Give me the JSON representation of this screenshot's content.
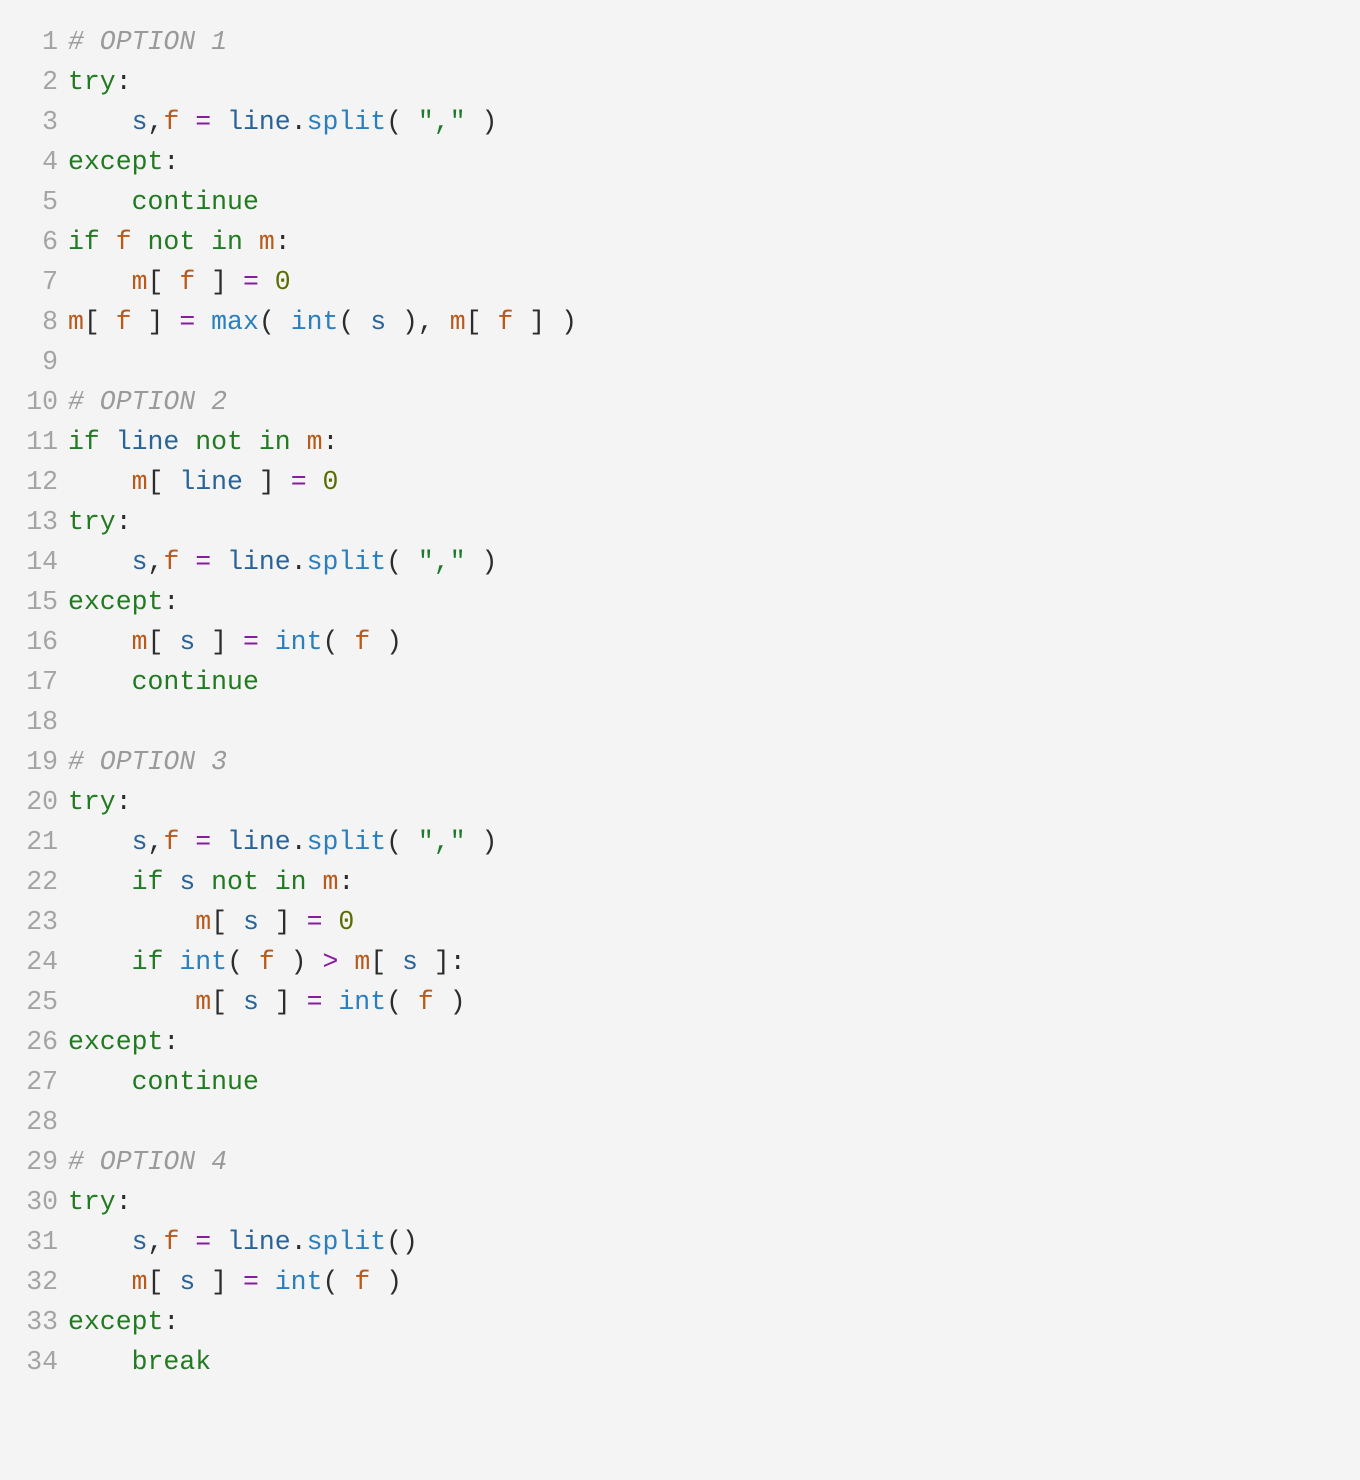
{
  "lines": [
    {
      "n": "1",
      "tokens": [
        {
          "c": "tok-cm",
          "t": "# OPTION 1"
        }
      ]
    },
    {
      "n": "2",
      "tokens": [
        {
          "c": "tok-kw",
          "t": "try"
        },
        {
          "c": "tok-id",
          "t": ":"
        }
      ]
    },
    {
      "n": "3",
      "tokens": [
        {
          "c": "tok-id",
          "t": "    "
        },
        {
          "c": "tok-v1",
          "t": "s"
        },
        {
          "c": "tok-id",
          "t": ","
        },
        {
          "c": "tok-v2",
          "t": "f"
        },
        {
          "c": "tok-id",
          "t": " "
        },
        {
          "c": "tok-op",
          "t": "="
        },
        {
          "c": "tok-id",
          "t": " "
        },
        {
          "c": "tok-v1",
          "t": "line"
        },
        {
          "c": "tok-id",
          "t": "."
        },
        {
          "c": "tok-fn",
          "t": "split"
        },
        {
          "c": "tok-id",
          "t": "( "
        },
        {
          "c": "tok-st",
          "t": "\",\""
        },
        {
          "c": "tok-id",
          "t": " )"
        }
      ]
    },
    {
      "n": "4",
      "tokens": [
        {
          "c": "tok-kw",
          "t": "except"
        },
        {
          "c": "tok-id",
          "t": ":"
        }
      ]
    },
    {
      "n": "5",
      "tokens": [
        {
          "c": "tok-id",
          "t": "    "
        },
        {
          "c": "tok-kw",
          "t": "continue"
        }
      ]
    },
    {
      "n": "6",
      "tokens": [
        {
          "c": "tok-kw",
          "t": "if"
        },
        {
          "c": "tok-id",
          "t": " "
        },
        {
          "c": "tok-v2",
          "t": "f"
        },
        {
          "c": "tok-id",
          "t": " "
        },
        {
          "c": "tok-kw",
          "t": "not in"
        },
        {
          "c": "tok-id",
          "t": " "
        },
        {
          "c": "tok-v2",
          "t": "m"
        },
        {
          "c": "tok-id",
          "t": ":"
        }
      ]
    },
    {
      "n": "7",
      "tokens": [
        {
          "c": "tok-id",
          "t": "    "
        },
        {
          "c": "tok-v2",
          "t": "m"
        },
        {
          "c": "tok-id",
          "t": "[ "
        },
        {
          "c": "tok-v2",
          "t": "f"
        },
        {
          "c": "tok-id",
          "t": " ] "
        },
        {
          "c": "tok-op",
          "t": "="
        },
        {
          "c": "tok-id",
          "t": " "
        },
        {
          "c": "tok-nu",
          "t": "0"
        }
      ]
    },
    {
      "n": "8",
      "tokens": [
        {
          "c": "tok-v2",
          "t": "m"
        },
        {
          "c": "tok-id",
          "t": "[ "
        },
        {
          "c": "tok-v2",
          "t": "f"
        },
        {
          "c": "tok-id",
          "t": " ] "
        },
        {
          "c": "tok-op",
          "t": "="
        },
        {
          "c": "tok-id",
          "t": " "
        },
        {
          "c": "tok-fn",
          "t": "max"
        },
        {
          "c": "tok-id",
          "t": "( "
        },
        {
          "c": "tok-fn",
          "t": "int"
        },
        {
          "c": "tok-id",
          "t": "( "
        },
        {
          "c": "tok-v1",
          "t": "s"
        },
        {
          "c": "tok-id",
          "t": " ), "
        },
        {
          "c": "tok-v2",
          "t": "m"
        },
        {
          "c": "tok-id",
          "t": "[ "
        },
        {
          "c": "tok-v2",
          "t": "f"
        },
        {
          "c": "tok-id",
          "t": " ] )"
        }
      ]
    },
    {
      "n": "9",
      "tokens": []
    },
    {
      "n": "10",
      "tokens": [
        {
          "c": "tok-cm",
          "t": "# OPTION 2"
        }
      ]
    },
    {
      "n": "11",
      "tokens": [
        {
          "c": "tok-kw",
          "t": "if"
        },
        {
          "c": "tok-id",
          "t": " "
        },
        {
          "c": "tok-v1",
          "t": "line"
        },
        {
          "c": "tok-id",
          "t": " "
        },
        {
          "c": "tok-kw",
          "t": "not in"
        },
        {
          "c": "tok-id",
          "t": " "
        },
        {
          "c": "tok-v2",
          "t": "m"
        },
        {
          "c": "tok-id",
          "t": ":"
        }
      ]
    },
    {
      "n": "12",
      "tokens": [
        {
          "c": "tok-id",
          "t": "    "
        },
        {
          "c": "tok-v2",
          "t": "m"
        },
        {
          "c": "tok-id",
          "t": "[ "
        },
        {
          "c": "tok-v1",
          "t": "line"
        },
        {
          "c": "tok-id",
          "t": " ] "
        },
        {
          "c": "tok-op",
          "t": "="
        },
        {
          "c": "tok-id",
          "t": " "
        },
        {
          "c": "tok-nu",
          "t": "0"
        }
      ]
    },
    {
      "n": "13",
      "tokens": [
        {
          "c": "tok-kw",
          "t": "try"
        },
        {
          "c": "tok-id",
          "t": ":"
        }
      ]
    },
    {
      "n": "14",
      "tokens": [
        {
          "c": "tok-id",
          "t": "    "
        },
        {
          "c": "tok-v1",
          "t": "s"
        },
        {
          "c": "tok-id",
          "t": ","
        },
        {
          "c": "tok-v2",
          "t": "f"
        },
        {
          "c": "tok-id",
          "t": " "
        },
        {
          "c": "tok-op",
          "t": "="
        },
        {
          "c": "tok-id",
          "t": " "
        },
        {
          "c": "tok-v1",
          "t": "line"
        },
        {
          "c": "tok-id",
          "t": "."
        },
        {
          "c": "tok-fn",
          "t": "split"
        },
        {
          "c": "tok-id",
          "t": "( "
        },
        {
          "c": "tok-st",
          "t": "\",\""
        },
        {
          "c": "tok-id",
          "t": " )"
        }
      ]
    },
    {
      "n": "15",
      "tokens": [
        {
          "c": "tok-kw",
          "t": "except"
        },
        {
          "c": "tok-id",
          "t": ":"
        }
      ]
    },
    {
      "n": "16",
      "tokens": [
        {
          "c": "tok-id",
          "t": "    "
        },
        {
          "c": "tok-v2",
          "t": "m"
        },
        {
          "c": "tok-id",
          "t": "[ "
        },
        {
          "c": "tok-v1",
          "t": "s"
        },
        {
          "c": "tok-id",
          "t": " ] "
        },
        {
          "c": "tok-op",
          "t": "="
        },
        {
          "c": "tok-id",
          "t": " "
        },
        {
          "c": "tok-fn",
          "t": "int"
        },
        {
          "c": "tok-id",
          "t": "( "
        },
        {
          "c": "tok-v2",
          "t": "f"
        },
        {
          "c": "tok-id",
          "t": " )"
        }
      ]
    },
    {
      "n": "17",
      "tokens": [
        {
          "c": "tok-id",
          "t": "    "
        },
        {
          "c": "tok-kw",
          "t": "continue"
        }
      ]
    },
    {
      "n": "18",
      "tokens": []
    },
    {
      "n": "19",
      "tokens": [
        {
          "c": "tok-cm",
          "t": "# OPTION 3"
        }
      ]
    },
    {
      "n": "20",
      "tokens": [
        {
          "c": "tok-kw",
          "t": "try"
        },
        {
          "c": "tok-id",
          "t": ":"
        }
      ]
    },
    {
      "n": "21",
      "tokens": [
        {
          "c": "tok-id",
          "t": "    "
        },
        {
          "c": "tok-v1",
          "t": "s"
        },
        {
          "c": "tok-id",
          "t": ","
        },
        {
          "c": "tok-v2",
          "t": "f"
        },
        {
          "c": "tok-id",
          "t": " "
        },
        {
          "c": "tok-op",
          "t": "="
        },
        {
          "c": "tok-id",
          "t": " "
        },
        {
          "c": "tok-v1",
          "t": "line"
        },
        {
          "c": "tok-id",
          "t": "."
        },
        {
          "c": "tok-fn",
          "t": "split"
        },
        {
          "c": "tok-id",
          "t": "( "
        },
        {
          "c": "tok-st",
          "t": "\",\""
        },
        {
          "c": "tok-id",
          "t": " )"
        }
      ]
    },
    {
      "n": "22",
      "tokens": [
        {
          "c": "tok-id",
          "t": "    "
        },
        {
          "c": "tok-kw",
          "t": "if"
        },
        {
          "c": "tok-id",
          "t": " "
        },
        {
          "c": "tok-v1",
          "t": "s"
        },
        {
          "c": "tok-id",
          "t": " "
        },
        {
          "c": "tok-kw",
          "t": "not in"
        },
        {
          "c": "tok-id",
          "t": " "
        },
        {
          "c": "tok-v2",
          "t": "m"
        },
        {
          "c": "tok-id",
          "t": ":"
        }
      ]
    },
    {
      "n": "23",
      "tokens": [
        {
          "c": "tok-id",
          "t": "        "
        },
        {
          "c": "tok-v2",
          "t": "m"
        },
        {
          "c": "tok-id",
          "t": "[ "
        },
        {
          "c": "tok-v1",
          "t": "s"
        },
        {
          "c": "tok-id",
          "t": " ] "
        },
        {
          "c": "tok-op",
          "t": "="
        },
        {
          "c": "tok-id",
          "t": " "
        },
        {
          "c": "tok-nu",
          "t": "0"
        }
      ]
    },
    {
      "n": "24",
      "tokens": [
        {
          "c": "tok-id",
          "t": "    "
        },
        {
          "c": "tok-kw",
          "t": "if"
        },
        {
          "c": "tok-id",
          "t": " "
        },
        {
          "c": "tok-fn",
          "t": "int"
        },
        {
          "c": "tok-id",
          "t": "( "
        },
        {
          "c": "tok-v2",
          "t": "f"
        },
        {
          "c": "tok-id",
          "t": " ) "
        },
        {
          "c": "tok-op",
          "t": ">"
        },
        {
          "c": "tok-id",
          "t": " "
        },
        {
          "c": "tok-v2",
          "t": "m"
        },
        {
          "c": "tok-id",
          "t": "[ "
        },
        {
          "c": "tok-v1",
          "t": "s"
        },
        {
          "c": "tok-id",
          "t": " ]:"
        }
      ]
    },
    {
      "n": "25",
      "tokens": [
        {
          "c": "tok-id",
          "t": "        "
        },
        {
          "c": "tok-v2",
          "t": "m"
        },
        {
          "c": "tok-id",
          "t": "[ "
        },
        {
          "c": "tok-v1",
          "t": "s"
        },
        {
          "c": "tok-id",
          "t": " ] "
        },
        {
          "c": "tok-op",
          "t": "="
        },
        {
          "c": "tok-id",
          "t": " "
        },
        {
          "c": "tok-fn",
          "t": "int"
        },
        {
          "c": "tok-id",
          "t": "( "
        },
        {
          "c": "tok-v2",
          "t": "f"
        },
        {
          "c": "tok-id",
          "t": " )"
        }
      ]
    },
    {
      "n": "26",
      "tokens": [
        {
          "c": "tok-kw",
          "t": "except"
        },
        {
          "c": "tok-id",
          "t": ":"
        }
      ]
    },
    {
      "n": "27",
      "tokens": [
        {
          "c": "tok-id",
          "t": "    "
        },
        {
          "c": "tok-kw",
          "t": "continue"
        }
      ]
    },
    {
      "n": "28",
      "tokens": []
    },
    {
      "n": "29",
      "tokens": [
        {
          "c": "tok-cm",
          "t": "# OPTION 4"
        }
      ]
    },
    {
      "n": "30",
      "tokens": [
        {
          "c": "tok-kw",
          "t": "try"
        },
        {
          "c": "tok-id",
          "t": ":"
        }
      ]
    },
    {
      "n": "31",
      "tokens": [
        {
          "c": "tok-id",
          "t": "    "
        },
        {
          "c": "tok-v1",
          "t": "s"
        },
        {
          "c": "tok-id",
          "t": ","
        },
        {
          "c": "tok-v2",
          "t": "f"
        },
        {
          "c": "tok-id",
          "t": " "
        },
        {
          "c": "tok-op",
          "t": "="
        },
        {
          "c": "tok-id",
          "t": " "
        },
        {
          "c": "tok-v1",
          "t": "line"
        },
        {
          "c": "tok-id",
          "t": "."
        },
        {
          "c": "tok-fn",
          "t": "split"
        },
        {
          "c": "tok-id",
          "t": "()"
        }
      ]
    },
    {
      "n": "32",
      "tokens": [
        {
          "c": "tok-id",
          "t": "    "
        },
        {
          "c": "tok-v2",
          "t": "m"
        },
        {
          "c": "tok-id",
          "t": "[ "
        },
        {
          "c": "tok-v1",
          "t": "s"
        },
        {
          "c": "tok-id",
          "t": " ] "
        },
        {
          "c": "tok-op",
          "t": "="
        },
        {
          "c": "tok-id",
          "t": " "
        },
        {
          "c": "tok-fn",
          "t": "int"
        },
        {
          "c": "tok-id",
          "t": "( "
        },
        {
          "c": "tok-v2",
          "t": "f"
        },
        {
          "c": "tok-id",
          "t": " )"
        }
      ]
    },
    {
      "n": "33",
      "tokens": [
        {
          "c": "tok-kw",
          "t": "except"
        },
        {
          "c": "tok-id",
          "t": ":"
        }
      ]
    },
    {
      "n": "34",
      "tokens": [
        {
          "c": "tok-id",
          "t": "    "
        },
        {
          "c": "tok-kw",
          "t": "break"
        }
      ]
    }
  ]
}
